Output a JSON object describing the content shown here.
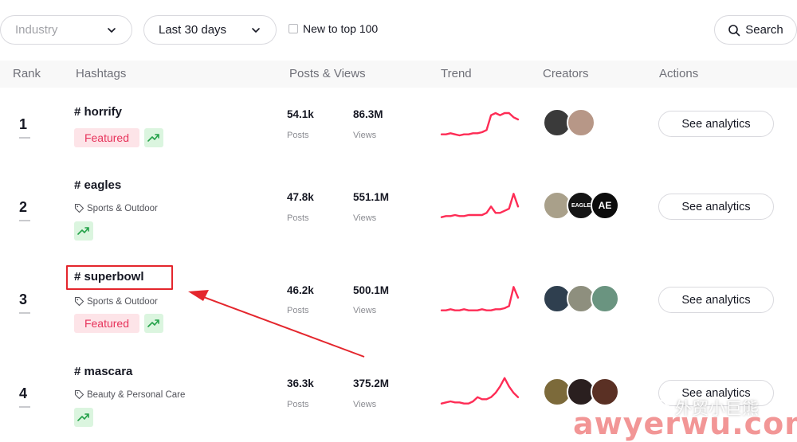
{
  "filters": {
    "industry_placeholder": "Industry",
    "period_label": "Last 30 days",
    "new_to_top_label": "New to top 100",
    "search_label": "Search"
  },
  "columns": [
    "Rank",
    "Hashtags",
    "Posts & Views",
    "Trend",
    "Creators",
    "Actions"
  ],
  "posts_label": "Posts",
  "views_label": "Views",
  "rows": [
    {
      "rank": "1",
      "hashtag": "# horrify",
      "category": "",
      "featured": "Featured",
      "posts": "54.1k",
      "views": "86.3M",
      "trend": [
        4,
        4,
        5,
        4,
        3,
        4,
        4,
        5,
        5,
        6,
        8,
        22,
        24,
        22,
        24,
        24,
        20,
        18
      ],
      "creators": [
        "#3a3a3a",
        "#b79787"
      ],
      "action": "See analytics"
    },
    {
      "rank": "2",
      "hashtag": "# eagles",
      "category": "Sports & Outdoor",
      "featured": "",
      "posts": "47.8k",
      "views": "551.1M",
      "trend": [
        4,
        5,
        5,
        6,
        5,
        5,
        6,
        6,
        6,
        6,
        8,
        14,
        8,
        8,
        10,
        12,
        26,
        14
      ],
      "creators": [
        "#a9a08a",
        "#151515",
        "#0c0c0c"
      ],
      "creator_texts": [
        "",
        "EAGLE",
        "AE"
      ],
      "action": "See analytics"
    },
    {
      "rank": "3",
      "hashtag": "# superbowl",
      "category": "Sports & Outdoor",
      "featured": "Featured",
      "posts": "46.2k",
      "views": "500.1M",
      "trend": [
        4,
        4,
        5,
        4,
        4,
        5,
        4,
        4,
        4,
        5,
        4,
        4,
        5,
        5,
        6,
        8,
        26,
        16
      ],
      "creators": [
        "#2f3f4f",
        "#8e8f7e",
        "#6a9480"
      ],
      "action": "See analytics"
    },
    {
      "rank": "4",
      "hashtag": "# mascara",
      "category": "Beauty & Personal Care",
      "featured": "",
      "posts": "36.3k",
      "views": "375.2M",
      "trend": [
        4,
        5,
        6,
        5,
        5,
        4,
        4,
        6,
        10,
        8,
        8,
        10,
        14,
        20,
        28,
        20,
        14,
        10
      ],
      "creators": [
        "#7c6a3a",
        "#2a1f1f",
        "#5a3024"
      ],
      "action": "See analytics"
    }
  ],
  "watermark": {
    "line1": "外贸小巨熊",
    "line2": "awyerwu.com"
  },
  "colors": {
    "accent": "#fe2c55",
    "featured_bg": "#fde4e8",
    "trend_badge": "#dbf5df",
    "annotation": "#e4262d"
  }
}
